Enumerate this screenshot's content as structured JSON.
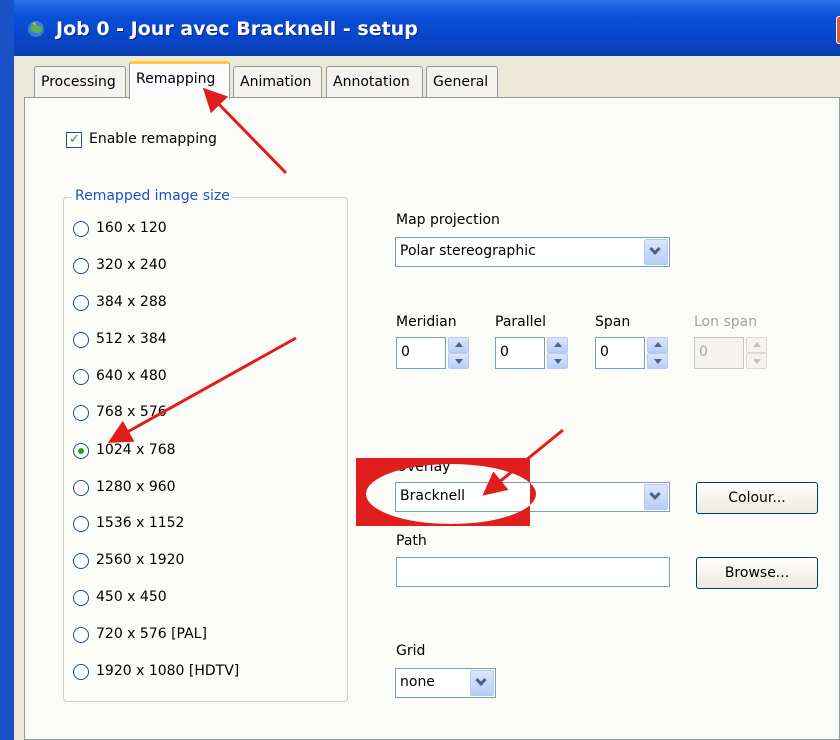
{
  "window": {
    "title": "Job 0 - Jour avec Bracknell - setup",
    "close_glyph": "✕"
  },
  "tabs": [
    {
      "label": "Processing",
      "active": false
    },
    {
      "label": "Remapping",
      "active": true
    },
    {
      "label": "Animation",
      "active": false
    },
    {
      "label": "Annotation",
      "active": false
    },
    {
      "label": "General",
      "active": false
    }
  ],
  "remapping": {
    "enable_label": "Enable remapping",
    "enable_checked": true,
    "check_glyph": "✓",
    "size_group_label": "Remapped image size",
    "sizes": [
      "160 x 120",
      "320 x 240",
      "384 x 288",
      "512 x 384",
      "640 x 480",
      "768 x 576",
      "1024 x 768",
      "1280 x 960",
      "1536 x 1152",
      "2560 x 1920",
      "450 x 450",
      "720 x 576 [PAL]",
      "1920 x 1080 [HDTV]"
    ],
    "selected_size": "1024 x 768",
    "map_projection": {
      "label": "Map projection",
      "value": "Polar stereographic"
    },
    "meridian": {
      "label": "Meridian",
      "value": "0"
    },
    "parallel": {
      "label": "Parallel",
      "value": "0"
    },
    "span": {
      "label": "Span",
      "value": "0"
    },
    "lon_span": {
      "label": "Lon span",
      "value": "0",
      "disabled": true
    },
    "overlay": {
      "label": "Overlay",
      "value": "Bracknell"
    },
    "colour_button": "Colour...",
    "path": {
      "label": "Path",
      "value": ""
    },
    "browse_button": "Browse...",
    "grid": {
      "label": "Grid",
      "value": "none"
    }
  },
  "colors": {
    "titlebar": "#0a4ed6",
    "dialog_bg": "#ece9d8",
    "accent_tab": "#ffc83c",
    "annotation_red": "#e01e1e"
  }
}
